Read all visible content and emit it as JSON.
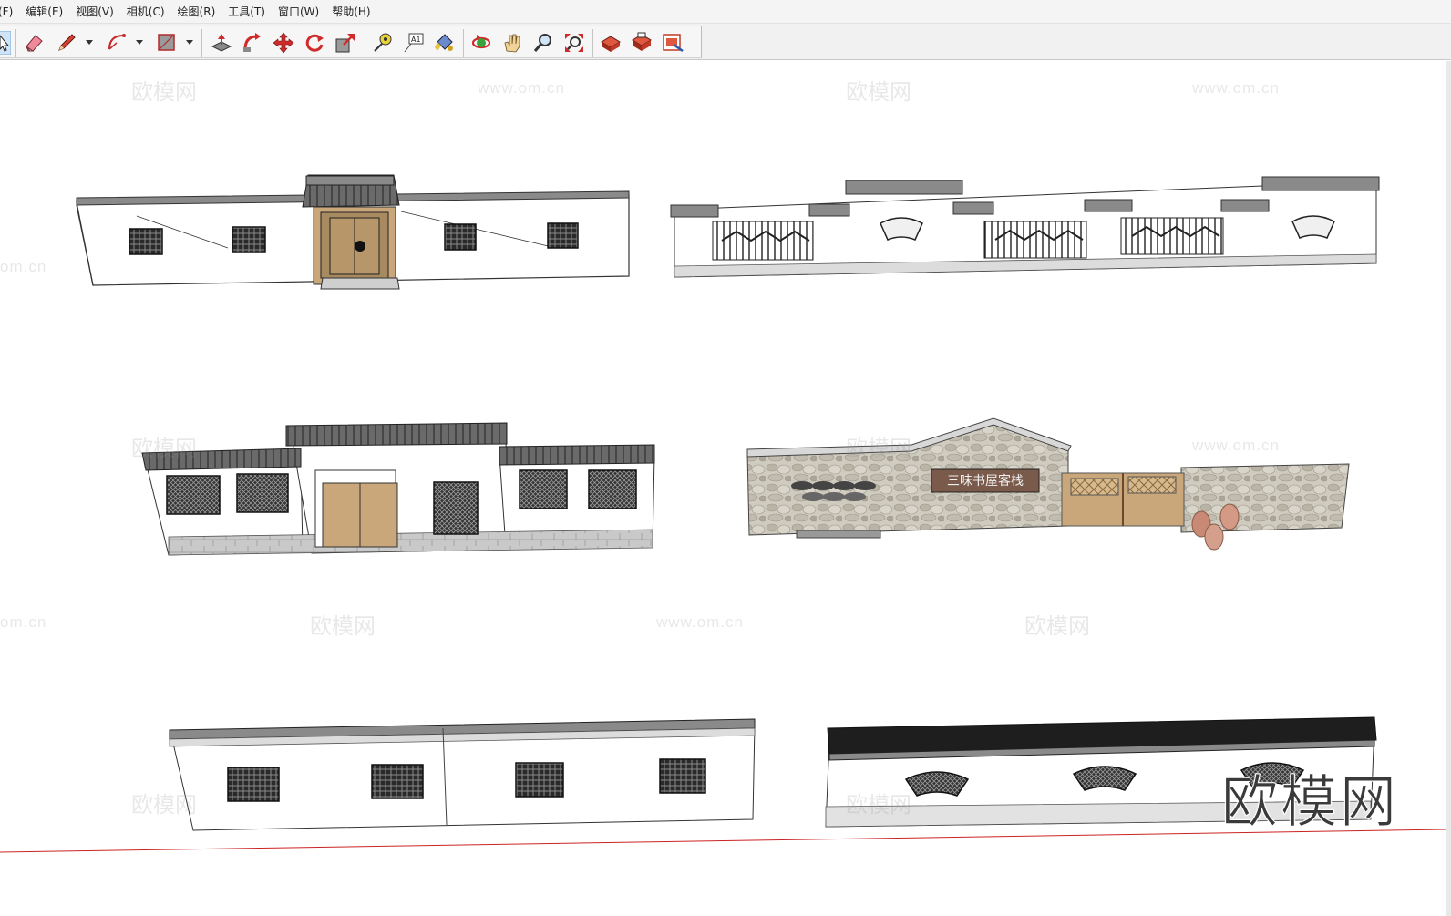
{
  "menu": {
    "items": [
      {
        "label": "(F)"
      },
      {
        "label": "编辑(E)"
      },
      {
        "label": "视图(V)"
      },
      {
        "label": "相机(C)"
      },
      {
        "label": "绘图(R)"
      },
      {
        "label": "工具(T)"
      },
      {
        "label": "窗口(W)"
      },
      {
        "label": "帮助(H)"
      }
    ]
  },
  "toolbar": {
    "tools": [
      {
        "name": "select-tool-icon"
      },
      {
        "name": "eraser-icon"
      },
      {
        "name": "pencil-icon"
      },
      {
        "name": "arc-icon"
      },
      {
        "name": "rectangle-icon"
      },
      {
        "name": "push-pull-icon"
      },
      {
        "name": "follow-me-icon"
      },
      {
        "name": "move-icon"
      },
      {
        "name": "rotate-icon"
      },
      {
        "name": "scale-icon"
      },
      {
        "name": "tape-measure-icon"
      },
      {
        "name": "text-icon"
      },
      {
        "name": "paint-bucket-icon"
      },
      {
        "name": "orbit-icon"
      },
      {
        "name": "pan-icon"
      },
      {
        "name": "zoom-icon"
      },
      {
        "name": "zoom-extents-icon"
      },
      {
        "name": "warehouse-icon"
      },
      {
        "name": "share-model-icon"
      },
      {
        "name": "extension-icon"
      }
    ],
    "text_tool_label": "A1"
  },
  "viewport": {
    "watermark_brand": "欧模网",
    "watermark_url": "www.om.cn",
    "watermark_url_cut": "om.cn",
    "plaque_text": "三味书屋客栈",
    "colors": {
      "wall": "#ffffff",
      "roof": "#6e6e6e",
      "stone": "#c9c5b8",
      "wood": "#c9a77a",
      "axis_red": "#cc2222"
    }
  }
}
